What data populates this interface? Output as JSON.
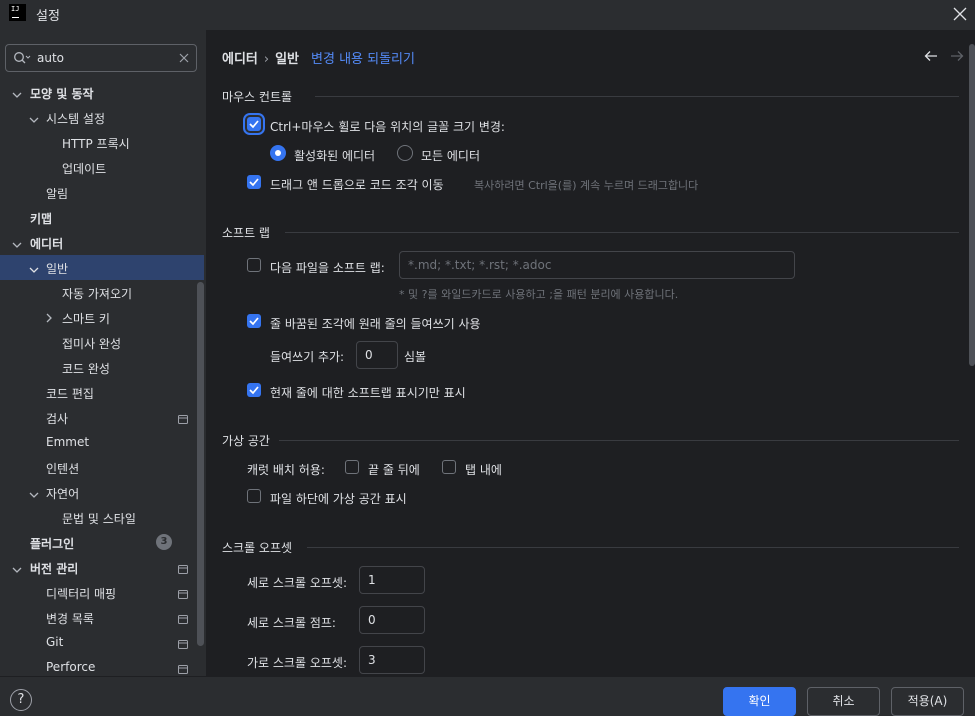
{
  "window": {
    "title": "설정",
    "logo_text": "IJ"
  },
  "search": {
    "value": "auto"
  },
  "sidebar": {
    "items": [
      {
        "label": "모양 및 동작"
      },
      {
        "label": "시스템 설정"
      },
      {
        "label": "HTTP 프록시"
      },
      {
        "label": "업데이트"
      },
      {
        "label": "알림"
      },
      {
        "label": "키맵"
      },
      {
        "label": "에디터"
      },
      {
        "label": "일반"
      },
      {
        "label": "자동 가져오기"
      },
      {
        "label": "스마트 키"
      },
      {
        "label": "접미사 완성"
      },
      {
        "label": "코드 완성"
      },
      {
        "label": "코드 편집"
      },
      {
        "label": "검사"
      },
      {
        "label": "Emmet"
      },
      {
        "label": "인텐션"
      },
      {
        "label": "자연어"
      },
      {
        "label": "문법 및 스타일"
      },
      {
        "label": "플러그인",
        "badge": "3"
      },
      {
        "label": "버전 관리"
      },
      {
        "label": "디렉터리 매핑"
      },
      {
        "label": "변경 목록"
      },
      {
        "label": "Git"
      },
      {
        "label": "Perforce"
      }
    ]
  },
  "breadcrumb": {
    "parent": "에디터",
    "current": "일반",
    "separator": "›",
    "revert": "변경 내용 되돌리기"
  },
  "mouse": {
    "title": "마우스 컨트롤",
    "zoom_label": "Ctrl+마우스 휠로 다음 위치의 글꼴 크기 변경:",
    "zoom_checked": true,
    "radio_active": "활성화된 에디터",
    "radio_all": "모든 에디터",
    "dnd_label": "드래그 앤 드롭으로 코드 조각 이동",
    "dnd_checked": true,
    "dnd_hint": "복사하려면 Ctrl을(를) 계속 누르며 드래그합니다"
  },
  "softwrap": {
    "title": "소프트 랩",
    "files_label": "다음 파일을 소프트 랩:",
    "files_checked": false,
    "files_placeholder": "*.md; *.txt; *.rst; *.adoc",
    "files_hint": "* 및 ?를 와일드카드로 사용하고 ;을 패턴 분리에 사용합니다.",
    "indent_label": "줄 바꿈된 조각에 원래 줄의 들여쓰기 사용",
    "indent_checked": true,
    "indent_add_label": "들여쓰기 추가:",
    "indent_add_value": "0",
    "indent_add_unit": "심볼",
    "current_line_label": "현재 줄에 대한 소프트랩 표시기만 표시",
    "current_line_checked": true
  },
  "virtual_space": {
    "title": "가상 공간",
    "caret_label": "캐럿 배치 허용:",
    "eol_label": "끝 줄 뒤에",
    "tab_label": "탭 내에",
    "file_end_label": "파일 하단에 가상 공간 표시"
  },
  "scroll_offset": {
    "title": "스크롤 오프셋",
    "vertical_offset_label": "세로 스크롤 오프셋:",
    "vertical_offset_value": "1",
    "vertical_jump_label": "세로 스크롤 점프:",
    "vertical_jump_value": "0",
    "horizontal_offset_label": "가로 스크롤 오프셋:",
    "horizontal_offset_value": "3"
  },
  "footer": {
    "help": "?",
    "ok": "확인",
    "cancel": "취소",
    "apply": "적용(A)"
  },
  "colors": {
    "accent": "#3574f0",
    "selection": "#2e436e",
    "link": "#548af7",
    "panel": "#2b2d30",
    "content": "#1e1f22"
  }
}
